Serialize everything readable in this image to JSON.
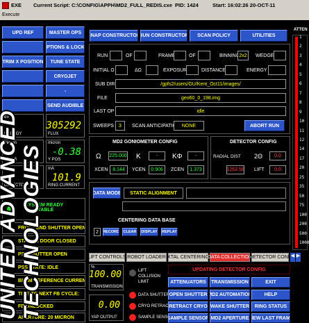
{
  "titlebar": {
    "app": "EXE",
    "script": "Current Script:  C:\\CONFIG\\APPH\\MD2_FULL_REDIS.cxe",
    "pid": "PID:  1424",
    "start": "Start:  16:02:26   20-OCT-11"
  },
  "menu": {
    "label": "Execute"
  },
  "left_buttons": [
    "UPD",
    "REF",
    "MASTER OPS",
    "",
    "OPTIONS & LOCKS",
    "TRIM X POSITION",
    "TUNE STATE",
    "",
    "CRYOJET",
    "",
    "-",
    "",
    "SEND AUDIBLE"
  ],
  "readouts": [
    {
      "label": "eV",
      "value": "",
      "unit": "ENERGY"
    },
    {
      "label": "",
      "value": "305292",
      "unit": "FLUX"
    },
    {
      "label": "micron",
      "value": "",
      "unit": "X POS"
    },
    {
      "label": "micron",
      "value": "-0.38",
      "unit": "Y POS"
    },
    {
      "label": "",
      "value": "",
      "unit": "DETECTOR"
    },
    {
      "label": "mA",
      "value": "101.9",
      "unit": "RING CURRENT"
    }
  ],
  "system_status": "SYSTEM READY\nSTABLE",
  "status_lines": [
    "FRONT END SHUTTER OPEN",
    "STATION DOOR CLOSED",
    "PSS SHUTTER OPEN",
    "PSS STATE: IDLE",
    "BEAM REFERENCE CURRENT",
    "TIME TO NEXT FB CYCLE:",
    "FB UNLOCKED",
    "APERTURE: 20 MICRON"
  ],
  "top_buttons": [
    "SNAP CONSTRUCTOR",
    "RUN CONSTRUCTOR",
    "SCAN POLICY",
    "UTILITIES"
  ],
  "run_row": {
    "run": "RUN",
    "of1": "OF",
    "frame": "FRAME",
    "of2": "OF",
    "binning": "BINNING",
    "binning_val": "2x2",
    "wedge": "WEDGE"
  },
  "row2": {
    "initial": "INITIAL Ω",
    "delta": "ΔΩ",
    "exposure": "EXPOSURE",
    "distance": "DISTANCE",
    "energy": "ENERGY"
  },
  "subdir": {
    "label": "SUB DIR",
    "value": "/gpfs2/users/GU/Kent_Oct11/images/"
  },
  "file": {
    "label": "FILE",
    "value": "geo60_0_198.img"
  },
  "last_op": {
    "label": "LAST OP",
    "value": "idle"
  },
  "sweeps": {
    "label": "SWEEPS",
    "value": "3",
    "anticipation": "SCAN ANTICIPATION",
    "anticipation_val": "NONE",
    "abort": "ABORT RUN"
  },
  "goniometer": {
    "title": "MD2 GONIOMETER CONFIG",
    "omega": "Ω",
    "omega_val": "225.000",
    "kappa": "K",
    "kappa_val": "-",
    "kphi": "KΦ",
    "kphi_val": "-",
    "xcen": "XCEN",
    "xcen_val": "8.144",
    "ycen": "YCEN",
    "ycen_val": "0.906",
    "zcen": "ZCEN",
    "zcen_val": "1.373"
  },
  "detector": {
    "title": "DETECTOR CONFIG",
    "radial": "RADIAL DIST",
    "radial_val": "1263.56",
    "two_theta": "2Θ",
    "two_theta_val": "0.0",
    "lift": "LIFT",
    "lift_val": "0.0"
  },
  "data_mode": {
    "button": "DATA MODE",
    "value": "STATIC ALIGNMENT"
  },
  "centering": {
    "title": "CENTERING DATA BASE",
    "count": "2",
    "buttons": [
      "RECORD",
      "CLEAR",
      "DISPLAY",
      "REPLAY"
    ]
  },
  "tabs": [
    "LIFT CONTROLS",
    "ROBOT LOADER",
    "XTAL CENTERING",
    "DATA COLLECTION",
    "DETECTOR CONF"
  ],
  "transmission": {
    "unit": "%",
    "value": "100.00",
    "label": "TRANSMISSION"
  },
  "yap": {
    "value": "0.00",
    "label": "YAP OUTPUT"
  },
  "leds": [
    "LIFT COLLISION LIMIT",
    "DATA SHUTTER",
    "CRYO RETRACT",
    "SAMPLE SENSOR"
  ],
  "banner": "UPDATING DETECTOR CONFIG",
  "bottom_buttons": [
    "ATTENUATORS",
    "TRANSMISSION",
    "EXIT",
    "OPEN SHUTTER",
    "MD2 AUTOMATION",
    "HELP",
    "RETRACT CRYO",
    "WAKE SHUTTER",
    "RING STATUS",
    "SAMPLE SENSOR",
    "MD2 APERTURE",
    "VIEW LAST FRAME"
  ],
  "atten": {
    "title": "ATTEN",
    "ticks": [
      "1",
      "2",
      "3",
      "4",
      "5",
      "6",
      "7",
      "8",
      "9",
      "10",
      "11",
      "12",
      "14",
      "17",
      "20",
      "25",
      "35",
      "50",
      "75",
      "100",
      "200",
      "500",
      "1000"
    ]
  },
  "watermark": "UNITED ADVANCED TECHNOLOGIES",
  "colors": {
    "accent_blue": "#2b55c8",
    "active_tab": "#e23030",
    "value_yellow": "#ffff00",
    "value_green": "#33ff33"
  }
}
